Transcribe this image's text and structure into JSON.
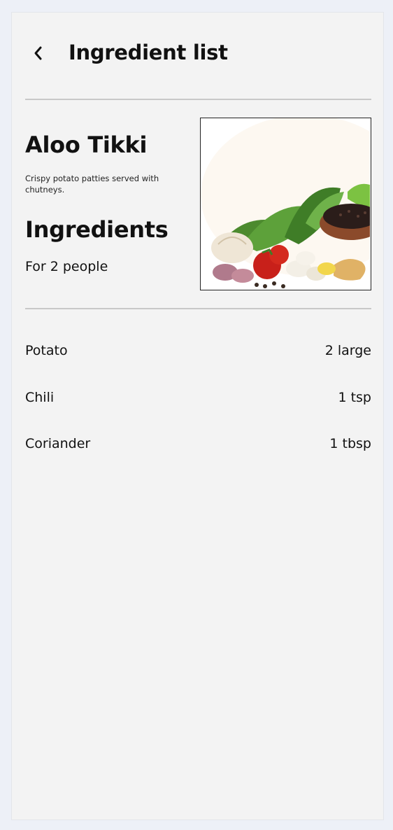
{
  "header": {
    "title": "Ingredient list",
    "back_icon": "chevron-left-icon"
  },
  "recipe": {
    "name": "Aloo Tikki",
    "description": "Crispy potato patties served with chutneys.",
    "image_icon": "vegetables-spices-image"
  },
  "ingredients_section": {
    "title": "Ingredients",
    "serves": "For 2 people",
    "items": [
      {
        "name": "Potato",
        "quantity": "2 large"
      },
      {
        "name": "Chili",
        "quantity": "1 tsp"
      },
      {
        "name": "Coriander",
        "quantity": "1 tbsp"
      }
    ]
  },
  "colors": {
    "page_background": "#edf0f7",
    "card_background": "#f3f3f3",
    "divider": "#c8c8c8",
    "text": "#111111"
  }
}
